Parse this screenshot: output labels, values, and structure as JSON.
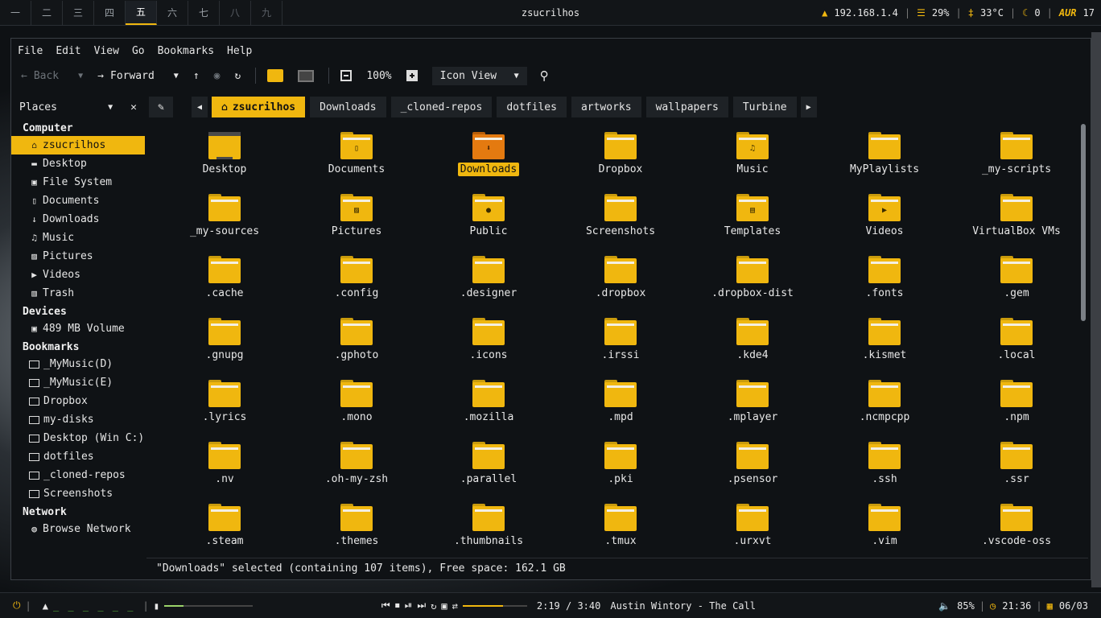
{
  "colors": {
    "accent": "#f0b70f",
    "bg": "#0f1215",
    "selected_folder": "#e47a10"
  },
  "topbar": {
    "workspaces": [
      "一",
      "二",
      "三",
      "四",
      "五",
      "六",
      "七",
      "八",
      "九"
    ],
    "active_workspace": 4,
    "window_title": "zsucrilhos",
    "ip": "192.168.1.4",
    "disk": "29%",
    "temp": "33°C",
    "moon_count": "0",
    "aur_label": "AUR",
    "aur_count": "17"
  },
  "menubar": {
    "items": [
      "File",
      "Edit",
      "View",
      "Go",
      "Bookmarks",
      "Help"
    ]
  },
  "toolbar": {
    "back": "Back",
    "forward": "Forward",
    "zoom": "100%",
    "view_mode": "Icon View"
  },
  "sidebar": {
    "title": "Places",
    "sections": {
      "computer": "Computer",
      "devices": "Devices",
      "bookmarks": "Bookmarks",
      "network": "Network"
    },
    "computer_items": [
      {
        "label": "zsucrilhos",
        "icon": "home-icon"
      },
      {
        "label": "Desktop",
        "icon": "desktop-icon"
      },
      {
        "label": "File System",
        "icon": "drive-icon"
      },
      {
        "label": "Documents",
        "icon": "document-icon"
      },
      {
        "label": "Downloads",
        "icon": "download-icon"
      },
      {
        "label": "Music",
        "icon": "music-icon"
      },
      {
        "label": "Pictures",
        "icon": "picture-icon"
      },
      {
        "label": "Videos",
        "icon": "video-icon"
      },
      {
        "label": "Trash",
        "icon": "trash-icon"
      }
    ],
    "device_items": [
      {
        "label": "489 MB Volume",
        "icon": "drive-icon"
      }
    ],
    "bookmark_items": [
      "_MyMusic(D)",
      "_MyMusic(E)",
      "Dropbox",
      "my-disks",
      " Desktop (Win C:)",
      "dotfiles",
      "_cloned-repos",
      "Screenshots"
    ],
    "network_items": [
      {
        "label": "Browse Network",
        "icon": "globe-icon"
      }
    ]
  },
  "locationbar": {
    "crumbs": [
      "zsucrilhos",
      "Downloads",
      "_cloned-repos",
      "dotfiles",
      "artworks",
      "wallpapers",
      "Turbine"
    ]
  },
  "files": [
    {
      "name": "Desktop",
      "emblem": "desktop"
    },
    {
      "name": "Documents",
      "emblem": "doc"
    },
    {
      "name": "Downloads",
      "emblem": "download",
      "selected": true
    },
    {
      "name": "Dropbox"
    },
    {
      "name": "Music",
      "emblem": "music"
    },
    {
      "name": "MyPlaylists"
    },
    {
      "name": "_my-scripts"
    },
    {
      "name": "_my-sources"
    },
    {
      "name": "Pictures",
      "emblem": "picture"
    },
    {
      "name": "Public",
      "emblem": "person"
    },
    {
      "name": "Screenshots"
    },
    {
      "name": "Templates",
      "emblem": "template"
    },
    {
      "name": "Videos",
      "emblem": "video"
    },
    {
      "name": "VirtualBox VMs"
    },
    {
      "name": ".cache"
    },
    {
      "name": ".config"
    },
    {
      "name": ".designer"
    },
    {
      "name": ".dropbox"
    },
    {
      "name": ".dropbox-dist"
    },
    {
      "name": ".fonts"
    },
    {
      "name": ".gem"
    },
    {
      "name": ".gnupg"
    },
    {
      "name": ".gphoto"
    },
    {
      "name": ".icons"
    },
    {
      "name": ".irssi"
    },
    {
      "name": ".kde4"
    },
    {
      "name": ".kismet"
    },
    {
      "name": ".local"
    },
    {
      "name": ".lyrics"
    },
    {
      "name": ".mono"
    },
    {
      "name": ".mozilla"
    },
    {
      "name": ".mpd"
    },
    {
      "name": ".mplayer"
    },
    {
      "name": ".ncmpcpp"
    },
    {
      "name": ".npm"
    },
    {
      "name": ".nv"
    },
    {
      "name": ".oh-my-zsh"
    },
    {
      "name": ".parallel"
    },
    {
      "name": ".pki"
    },
    {
      "name": ".psensor"
    },
    {
      "name": ".ssh"
    },
    {
      "name": ".ssr"
    },
    {
      "name": ".steam"
    },
    {
      "name": ".themes"
    },
    {
      "name": ".thumbnails"
    },
    {
      "name": ".tmux"
    },
    {
      "name": ".urxvt"
    },
    {
      "name": ".vim"
    },
    {
      "name": ".vscode-oss"
    }
  ],
  "status": "\"Downloads\" selected (containing 107 items), Free space: 162.1 GB",
  "bottombar": {
    "player_time": "2:19 / 3:40",
    "track": "Austin Wintory - The Call",
    "volume": "85%",
    "clock": "21:36",
    "date": "06/03"
  }
}
